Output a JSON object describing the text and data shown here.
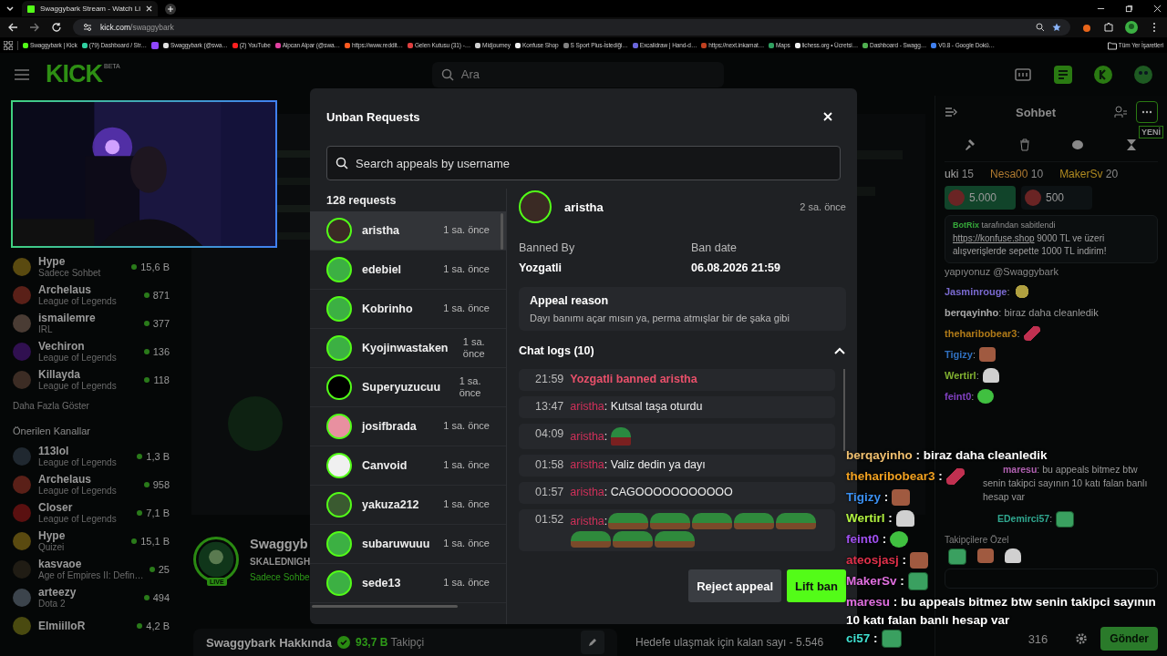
{
  "browser": {
    "tab_title": "Swaggybark Stream - Watch Li",
    "url_domain": "kick.com",
    "url_path": "/swaggybark",
    "bookmarks": [
      {
        "kind": "link",
        "title": "Swaggybark | Kick",
        "color": "#53fc18"
      },
      {
        "kind": "link",
        "title": "(79) Dashboard / Str…",
        "color": "#2fd0a0"
      },
      {
        "kind": "icon",
        "color": "#9146ff"
      },
      {
        "kind": "link",
        "title": "Swaggybark (@swa…",
        "color": "#e0e0e0"
      },
      {
        "kind": "link",
        "title": "(2) YouTube",
        "color": "#ff2020"
      },
      {
        "kind": "link",
        "title": "Alpcan Alpar (@swa…",
        "color": "#e040a0"
      },
      {
        "kind": "link",
        "title": "https://www.reddit…",
        "color": "#ff5a20"
      },
      {
        "kind": "link",
        "title": "Gelen Kutusu (31) -…",
        "color": "#e04040"
      },
      {
        "kind": "link",
        "title": "Midjourney",
        "color": "#d0d0d0"
      },
      {
        "kind": "link",
        "title": "Konfuse Shop",
        "color": "#f0f0f0"
      },
      {
        "kind": "link",
        "title": "S Sport Plus-İstediği…",
        "color": "#808080"
      },
      {
        "kind": "link",
        "title": "Excalidraw | Hand-d…",
        "color": "#6965db"
      },
      {
        "kind": "link",
        "title": "https://next.inkamat…",
        "color": "#c04020"
      },
      {
        "kind": "link",
        "title": "Maps",
        "color": "#30a060"
      },
      {
        "kind": "link",
        "title": "lichess.org • Ücretsi…",
        "color": "#f0f0f0"
      },
      {
        "kind": "link",
        "title": "Dashboard - Swagg…",
        "color": "#50b050"
      },
      {
        "kind": "link",
        "title": "V0.8 - Google Dokü…",
        "color": "#4080f0"
      }
    ],
    "all_bookmarks": "Tüm Yer İşaretleri"
  },
  "header": {
    "logo": "KICK",
    "logo_badge": "BETA",
    "search_placeholder": "Ara"
  },
  "sidebar": {
    "followed": [
      {
        "name": "Hype",
        "category": "Sadece Sohbet",
        "viewers": "15,6 B",
        "color": "#5a4a10"
      },
      {
        "name": "Archelaus",
        "category": "League of Legends",
        "viewers": "871",
        "color": "#5a2018"
      },
      {
        "name": "ismailemre",
        "category": "IRL",
        "viewers": "377",
        "color": "#4a3c34"
      },
      {
        "name": "Vechiron",
        "category": "League of Legends",
        "viewers": "136",
        "color": "#301050"
      },
      {
        "name": "Killayda",
        "category": "League of Legends",
        "viewers": "118",
        "color": "#3c2c24"
      }
    ],
    "show_more": "Daha Fazla Göster",
    "recommended_title": "Önerilen Kanallar",
    "recommended": [
      {
        "name": "113lol",
        "category": "League of Legends",
        "viewers": "1,3 B",
        "color": "#202830"
      },
      {
        "name": "Archelaus",
        "category": "League of Legends",
        "viewers": "958",
        "color": "#5a2018"
      },
      {
        "name": "Closer",
        "category": "League of Legends",
        "viewers": "7,1 B",
        "color": "#5a1010"
      },
      {
        "name": "Hype",
        "category": "Quizei",
        "viewers": "15,1 B",
        "color": "#5a4a10"
      },
      {
        "name": "kasvaoe",
        "category": "Age of Empires II: Defin…",
        "viewers": "25",
        "color": "#201c14"
      },
      {
        "name": "arteezy",
        "category": "Dota 2",
        "viewers": "494",
        "color": "#3c444c"
      },
      {
        "name": "ElmiilloR",
        "viewers": "4,2 B",
        "color": "#4a4a10"
      }
    ]
  },
  "channel": {
    "name": "Swaggyb",
    "title": "SKALEDNIGH",
    "category": "Sadece Sohbe",
    "live_badge": "LIVE",
    "about_title": "Swaggybark Hakkında",
    "followers": "93,7 B",
    "followers_label": "Takipçi",
    "goal": "Hedefe ulaşmak için kalan sayı - 5.546"
  },
  "chat": {
    "title": "Sohbet",
    "new_badge": "YENİ",
    "leaders": [
      {
        "name": "uki",
        "score": "15",
        "color": "#a8a8a8"
      },
      {
        "name": "Nesa00",
        "score": "10",
        "color": "#b07a30"
      },
      {
        "name": "MakerSv",
        "score": "20",
        "color": "#b08a20"
      }
    ],
    "gifts": [
      {
        "amount": "5.000",
        "highlighted": true
      },
      {
        "amount": "500",
        "highlighted": false
      }
    ],
    "pinned": {
      "author": "BotRix",
      "label": "tarafından sabitlendi",
      "link": "https://konfuse.shop",
      "message": "9000 TL ve üzeri alışverişlerde sepette 1000 TL indirim!"
    },
    "partial_message": "yapıyonuz @Swaggybark",
    "messages": [
      {
        "user": "Jasminrouge",
        "color": "#7a6ad0",
        "text": ":",
        "emote": {
          "kind": "smiley"
        }
      },
      {
        "user": "berqayinho",
        "color": "#a8a8a8",
        "text": ": biraz daha cleanledik"
      },
      {
        "user": "theharibobear3",
        "color": "#b07a18",
        "text": ":",
        "emote": {
          "kind": "rocket"
        }
      },
      {
        "user": "Tigizy",
        "color": "#3070c0",
        "text": ":",
        "emote": {
          "kind": "face"
        }
      },
      {
        "user": "Wertirl",
        "color": "#80b030",
        "text": ":",
        "emote": {
          "kind": "ghost"
        }
      },
      {
        "user": "feint0",
        "color": "#8040c0",
        "text": ":",
        "emote": {
          "kind": "blob"
        }
      }
    ],
    "lower_messages": [
      {
        "user": "maresu",
        "color": "#b060b0",
        "text": ": bu appeals bitmez btw senin takipci sayının 10 katı falan banlı hesap var"
      },
      {
        "user": "EDemirci57",
        "color": "#30a890",
        "text": ":",
        "emote": {
          "kind": "frog"
        }
      }
    ],
    "followers_only": "Takipçilere Özel",
    "points": "316",
    "send": "Gönder"
  },
  "modal": {
    "title": "Unban Requests",
    "search_placeholder": "Search appeals by username",
    "count": "128 requests",
    "requests": [
      {
        "name": "aristha",
        "time": "1 sa. önce",
        "selected": true,
        "color": "#3a2a24"
      },
      {
        "name": "edebiel",
        "time": "1 sa. önce",
        "selected": false,
        "color": "#3cb043"
      },
      {
        "name": "Kobrinho",
        "time": "1 sa. önce",
        "selected": false,
        "color": "#3cb043"
      },
      {
        "name": "Kyojinwastaken",
        "time": "1 sa. önce",
        "selected": false,
        "color": "#3cb043"
      },
      {
        "name": "Superyuzucuu",
        "time": "1 sa. önce",
        "selected": false,
        "color": "#000000"
      },
      {
        "name": "josifbrada",
        "time": "1 sa. önce",
        "selected": false,
        "color": "#e890a0"
      },
      {
        "name": "Canvoid",
        "time": "1 sa. önce",
        "selected": false,
        "color": "#f0f0f0"
      },
      {
        "name": "yakuza212",
        "time": "1 sa. önce",
        "selected": false,
        "color": "#3a5a30"
      },
      {
        "name": "subaruwuuu",
        "time": "1 sa. önce",
        "selected": false,
        "color": "#3cb043"
      },
      {
        "name": "sede13",
        "time": "1 sa. önce",
        "selected": false,
        "color": "#3cb043"
      }
    ],
    "detail": {
      "name": "aristha",
      "time": "2 sa. önce",
      "banned_by_label": "Banned By",
      "banned_by": "Yozgatli",
      "ban_date_label": "Ban date",
      "ban_date": "06.08.2026 21:59",
      "reason_title": "Appeal reason",
      "reason": "Dayı banımı açar mısın ya, perma atmışlar bir de şaka gibi",
      "logs_title": "Chat logs (10)",
      "logs_expanded": true,
      "logs": [
        {
          "kind": "ban",
          "time": "21:59",
          "text": "Yozgatli banned aristha"
        },
        {
          "kind": "message",
          "time": "13:47",
          "user": "aristha",
          "text": ": Kutsal taşa oturdu"
        },
        {
          "kind": "emote",
          "time": "04:09",
          "user": "aristha",
          "text": ":",
          "emotes": [
            {
              "kind": "frog_mouth"
            }
          ]
        },
        {
          "kind": "message",
          "time": "01:58",
          "user": "aristha",
          "text": ": Valiz dedin ya dayı"
        },
        {
          "kind": "message",
          "time": "01:57",
          "user": "aristha",
          "text": ": CAGOOOOOOOOOOO"
        },
        {
          "kind": "emote",
          "time": "01:52",
          "user": "aristha",
          "text": ":",
          "emotes": [
            {
              "kind": "frog_row"
            },
            {
              "kind": "frog_row"
            },
            {
              "kind": "frog_row"
            },
            {
              "kind": "frog_row"
            },
            {
              "kind": "frog_row"
            },
            {
              "kind": "frog_row"
            },
            {
              "kind": "frog_row"
            },
            {
              "kind": "frog_row"
            }
          ]
        }
      ]
    },
    "buttons": [
      {
        "kind": "secondary",
        "label": "Reject appeal"
      },
      {
        "kind": "primary",
        "label": "Lift ban"
      }
    ]
  },
  "overlay_chat": [
    {
      "user": "berqayinho",
      "color": "#f0c070",
      "text": ": biraz daha cleanledik"
    },
    {
      "user": "theharibobear3",
      "color": "#f0a020",
      "text": ":",
      "emote": {
        "kind": "rocket"
      }
    },
    {
      "user": "Tigizy",
      "color": "#3a8ff0",
      "text": ":",
      "emote": {
        "kind": "face"
      }
    },
    {
      "user": "Wertirl",
      "color": "#b0f040",
      "text": ":",
      "emote": {
        "kind": "ghost"
      }
    },
    {
      "user": "feint0",
      "color": "#a050f0",
      "text": ":",
      "emote": {
        "kind": "blob"
      }
    },
    {
      "user": "ateosjasj",
      "color": "#e0304a",
      "text": ":",
      "emote": {
        "kind": "face"
      }
    },
    {
      "user": "MakerSv",
      "color": "#e070e0",
      "text": ":",
      "emote": {
        "kind": "frog"
      }
    },
    {
      "user": "maresu",
      "color": "#e070e0",
      "text": ": bu appeals bitmez btw senin takipci sayının 10 katı falan banlı hesap var"
    },
    {
      "user": "ci57",
      "color": "#40e0d0",
      "text": ":",
      "emote": {
        "kind": "frog"
      }
    }
  ]
}
